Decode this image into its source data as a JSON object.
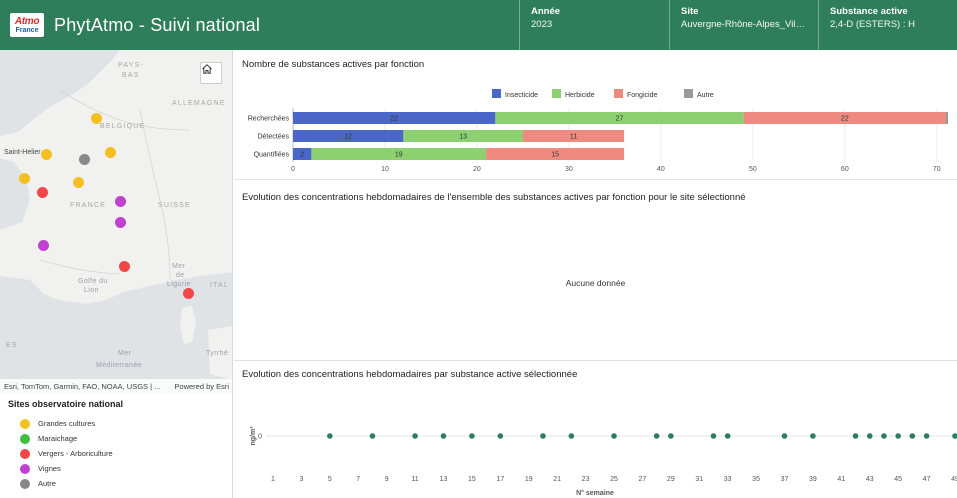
{
  "header": {
    "logo_top": "Atmo",
    "logo_bottom": "France",
    "title": "PhytAtmo - Suivi national",
    "fields": [
      {
        "label": "Année",
        "value": "2023"
      },
      {
        "label": "Site",
        "value": "Auvergne-Rhône-Alpes_Villefr..."
      },
      {
        "label": "Substance active",
        "value": "2,4-D (ESTERS) : H"
      }
    ]
  },
  "map": {
    "labels": {
      "pays": "PAYS-",
      "bas": "BAS",
      "allemagne": "ALLEMAGNE",
      "belgique": "BELGIQUE",
      "saint_helier": "Saint-Helier",
      "france": "FRANCE",
      "suisse": "SUISSE",
      "golfe_line1": "Golfe du",
      "golfe_line2": "Lion",
      "mer_ligurie_1": "Mer",
      "mer_ligurie_2": "de",
      "mer_ligurie_3": "Ligurie",
      "ital": "ITAL",
      "es": "ES",
      "mer_med_1": "Mer",
      "mer_med_2": "Méditerranée",
      "tyrrhe": "Tyrrhé"
    },
    "attribution": "Esri, TomTom, Garmin, FAO, NOAA, USGS | ...",
    "powered_by": "Powered by Esri",
    "home_icon": "home-icon",
    "site_types": [
      "grandes_cultures",
      "grandes_cultures",
      "grandes_cultures",
      "autre",
      "grandes_cultures",
      "grandes_cultures",
      "grandes_cultures",
      "vergers",
      "vignes",
      "vignes",
      "vignes",
      "vergers",
      "vergers"
    ]
  },
  "legend": {
    "title": "Sites observatoire national",
    "items": [
      {
        "label": "Grandes cultures",
        "color": "#f4c020"
      },
      {
        "label": "Maraichage",
        "color": "#3fbf3f"
      },
      {
        "label": "Vergers - Arboriculture",
        "color": "#f04848"
      },
      {
        "label": "Vignes",
        "color": "#c040d0"
      },
      {
        "label": "Autre",
        "color": "#888888"
      }
    ]
  },
  "chart1": {
    "title": "Nombre de substances actives par fonction",
    "chart_data": {
      "type": "bar",
      "orientation": "horizontal",
      "stacked": true,
      "categories": [
        "Recherchées",
        "Détectées",
        "Quantifiées"
      ],
      "series": [
        {
          "name": "Insecticide",
          "color": "#4a66c8",
          "values": [
            22,
            12,
            2
          ]
        },
        {
          "name": "Herbicide",
          "color": "#8cd070",
          "values": [
            27,
            13,
            19
          ]
        },
        {
          "name": "Fongicide",
          "color": "#ef8a80",
          "values": [
            22,
            11,
            15
          ]
        },
        {
          "name": "Autre",
          "color": "#9a9a9a",
          "values": [
            1,
            0,
            0
          ]
        }
      ],
      "xticks": [
        0,
        10,
        20,
        30,
        40,
        50,
        60,
        70
      ],
      "xlim": [
        0,
        71
      ],
      "legend": "top-center"
    }
  },
  "chart2": {
    "title": "Evolution des concentrations hebdomadaires de l'ensemble des substances actives par fonction pour le site sélectionné",
    "no_data": "Aucune donnée"
  },
  "chart3": {
    "title": "Evolution des concentrations hebdomadaires par substance active sélectionnée",
    "chart_data": {
      "type": "scatter",
      "xlabel": "N° semaine",
      "ylabel": "ng/m³",
      "xticks": [
        1,
        3,
        5,
        7,
        9,
        11,
        13,
        15,
        17,
        19,
        21,
        23,
        25,
        27,
        29,
        31,
        33,
        35,
        37,
        39,
        41,
        43,
        45,
        47,
        49
      ],
      "yticks": [
        0
      ],
      "xlim": [
        1,
        49
      ],
      "x": [
        5,
        8,
        11,
        13,
        15,
        17,
        20,
        22,
        25,
        28,
        29,
        32,
        33,
        37,
        39,
        42,
        43,
        44,
        45,
        46,
        47,
        49
      ],
      "y": [
        0,
        0,
        0,
        0,
        0,
        0,
        0,
        0,
        0,
        0,
        0,
        0,
        0,
        0,
        0,
        0,
        0,
        0,
        0,
        0,
        0,
        0
      ],
      "color": "#2e7d5b"
    }
  }
}
